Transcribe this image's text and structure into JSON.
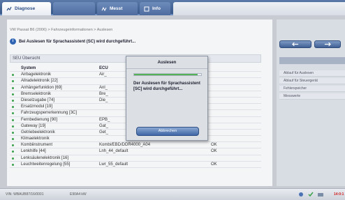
{
  "tabs": [
    {
      "label": "Diagnose",
      "active": true
    },
    {
      "label": "",
      "active": false
    },
    {
      "label": "Messt",
      "active": false
    },
    {
      "label": "Info",
      "active": false
    }
  ],
  "breadcrumb": "VW Passat B6 (2006) > Fahrzeugeinformationen > Auslesen",
  "status_message": "Bei Auslesen für Sprachassistent (SC) wird durchgeführt...",
  "ecu_header": "SEU Übersicht",
  "table": {
    "headers": {
      "system": "System",
      "ecu": "ECU",
      "status": ""
    },
    "rows": [
      {
        "system": "Airbagelektronik",
        "ecu": "Air_",
        "status": ""
      },
      {
        "system": "Allradelektronik [22]",
        "ecu": "",
        "status": ""
      },
      {
        "system": "Anhängerfunktion [69]",
        "ecu": "Anl_",
        "status": ""
      },
      {
        "system": "Bremselektronik",
        "ecu": "Bre_",
        "status": ""
      },
      {
        "system": "Dieselzugabe [74]",
        "ecu": "Die_",
        "status": ""
      },
      {
        "system": "Ersatzmodul [19]",
        "ecu": "",
        "status": ""
      },
      {
        "system": "Fahrzeugsperrerkennung [3C]",
        "ecu": "",
        "status": ""
      },
      {
        "system": "Fernbedienung [90]",
        "ecu": "EPB_",
        "status": ""
      },
      {
        "system": "Gateway [19]",
        "ecu": "Gat_",
        "status": ""
      },
      {
        "system": "Getriebeelektronik",
        "ecu": "Get_",
        "status": ""
      },
      {
        "system": "Klimaelektronik",
        "ecu": "",
        "status": ""
      },
      {
        "system": "Kombiinstrument",
        "ecu": "Kombi/EBD/DDR4000_A04",
        "status": "OK"
      },
      {
        "system": "Lenkhilfe [44]",
        "ecu": "Lnh_44_default",
        "status": "OK"
      },
      {
        "system": "Lenksäulenelektronik [16]",
        "ecu": "",
        "status": ""
      },
      {
        "system": "Leuchtweitenregelung [55]",
        "ecu": "Lwr_55_default",
        "status": "OK"
      }
    ]
  },
  "dialog": {
    "title": "Auslesen",
    "progress": 0.95,
    "message": "Der Auslesen für Sprachassistent [SC] wird durchgeführt...",
    "cancel_label": "Abbrechen"
  },
  "side_items": [
    "Ablauf für Auslesen",
    "Ablauf für Steuergerät",
    "Fehlerspeicher",
    "Messwerte"
  ],
  "bottom": {
    "vin": "VIN: WBAUB87/16/0001",
    "info": "E90A4 kW",
    "alert": "14:0:1"
  },
  "colors": {
    "accent": "#39598a",
    "ok_dot": "#3aa14a",
    "progress": "#3f9d45",
    "alert": "#d02020"
  }
}
